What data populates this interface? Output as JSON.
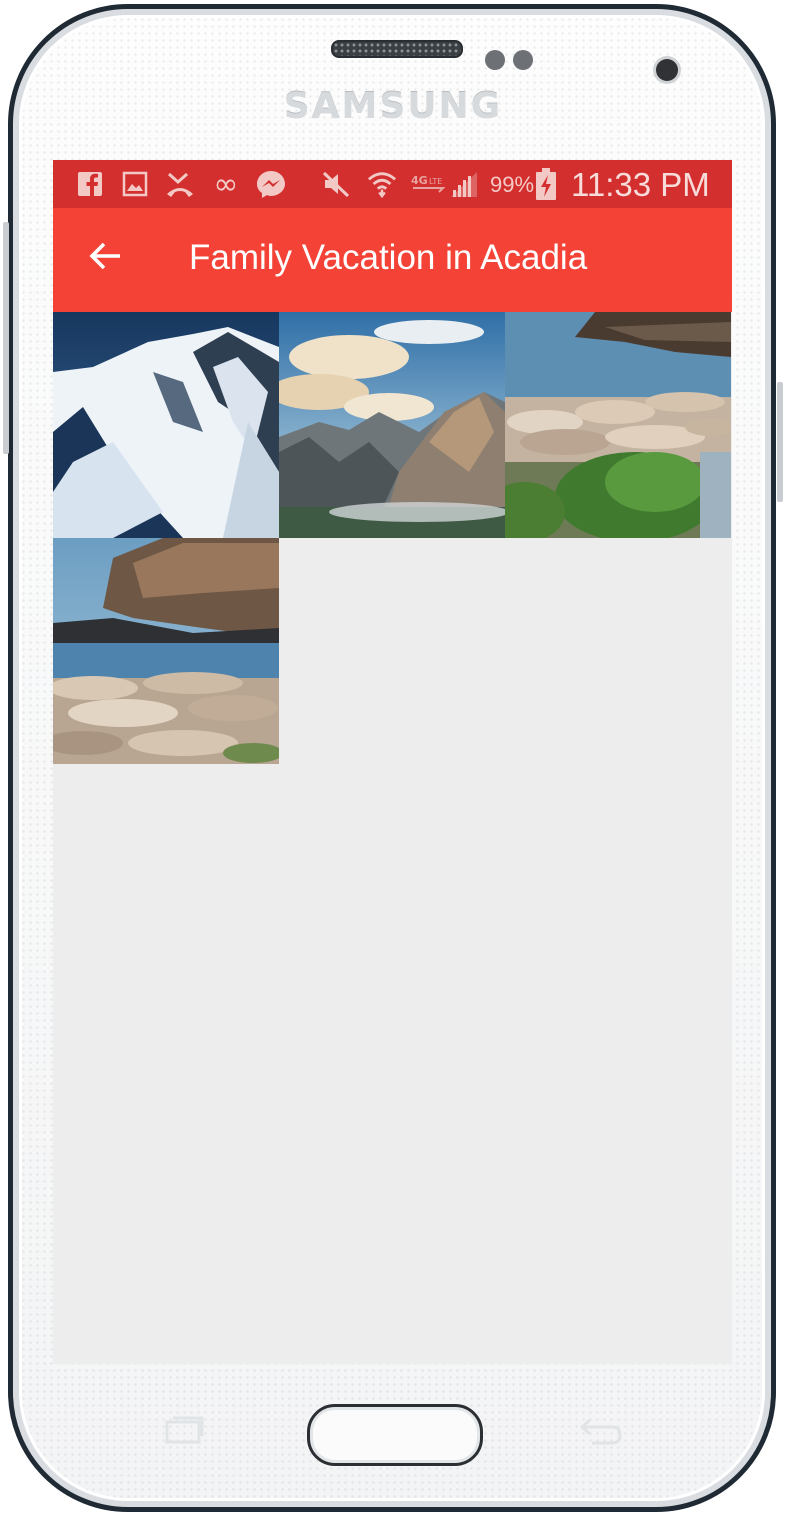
{
  "device": {
    "brand": "SAMSUNG"
  },
  "status_bar": {
    "icons": [
      "facebook-icon",
      "gallery-icon",
      "missed-call-icon",
      "infinity-icon",
      "messenger-icon",
      "mute-icon",
      "wifi-icon",
      "lte-icon",
      "signal-icon",
      "battery-charging-icon"
    ],
    "battery_percent": "99%",
    "time": "11:33 PM",
    "color": "#d32f2f"
  },
  "app_bar": {
    "title": "Family Vacation in Acadia",
    "back_icon": "arrow-back-icon",
    "color": "#f44336"
  },
  "photos": [
    {
      "id": "photo-1",
      "subject": "snowy mountain"
    },
    {
      "id": "photo-2",
      "subject": "mountain range with clouds"
    },
    {
      "id": "photo-3",
      "subject": "rocky shoreline with shrubs"
    },
    {
      "id": "photo-4",
      "subject": "coastal cliffs and rocks"
    }
  ],
  "screen_background": "#ededed"
}
